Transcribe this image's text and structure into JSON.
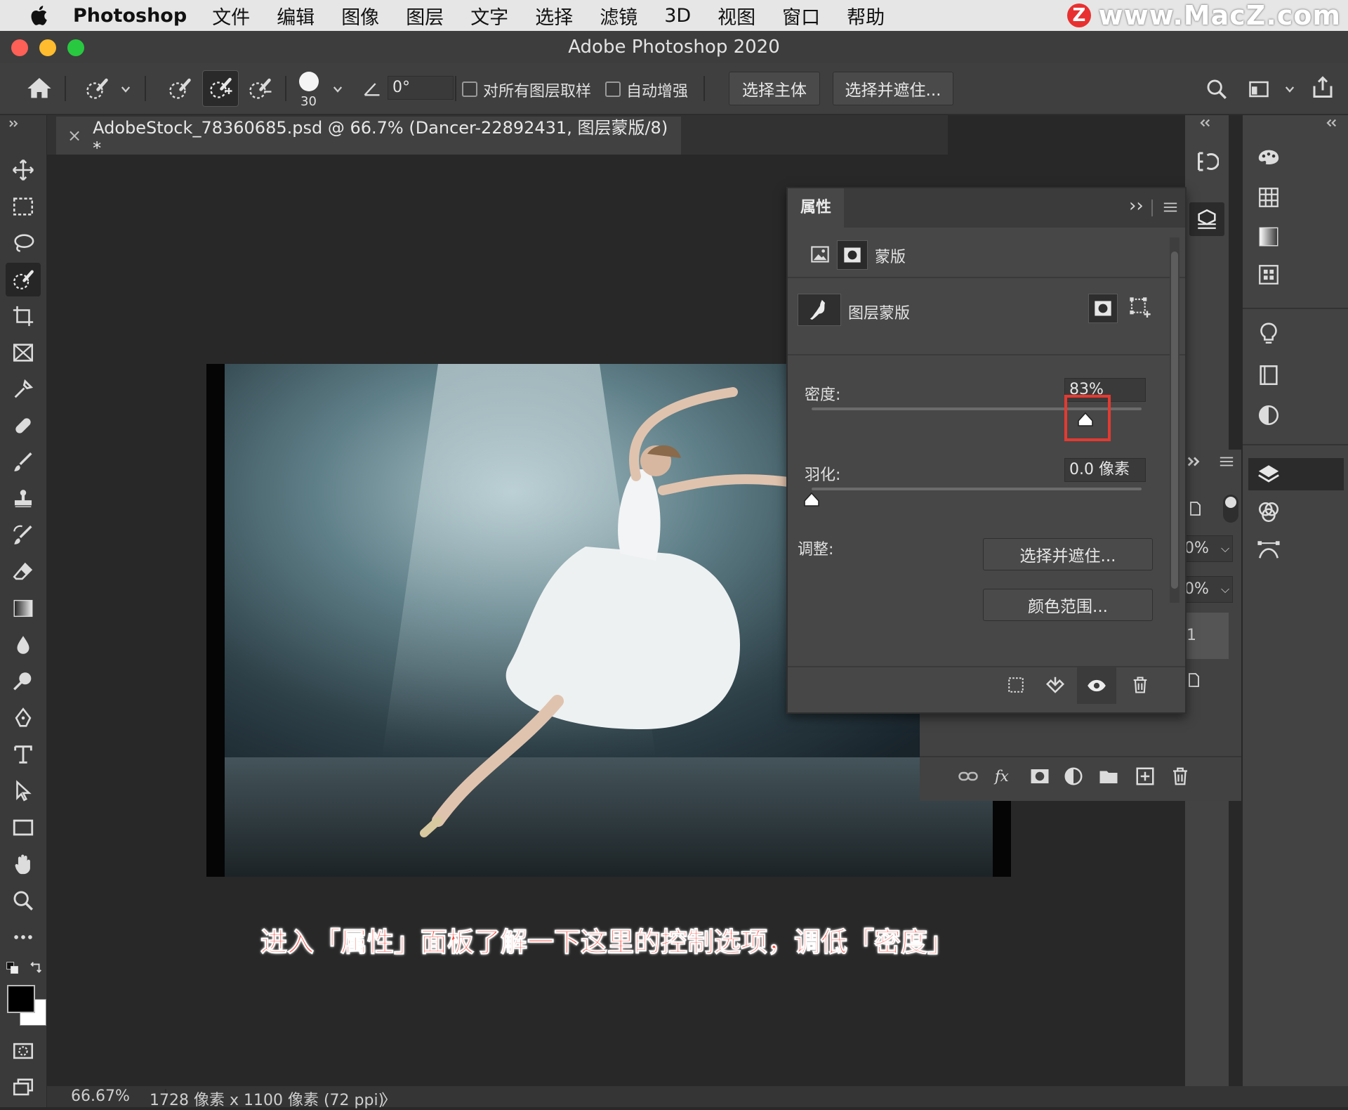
{
  "menubar": {
    "app_name": "Photoshop",
    "items": [
      "文件",
      "编辑",
      "图像",
      "图层",
      "文字",
      "选择",
      "滤镜",
      "3D",
      "视图",
      "窗口",
      "帮助"
    ],
    "watermark": "www.MacZ.com",
    "watermark_badge": "Z"
  },
  "window": {
    "title": "Adobe Photoshop 2020",
    "traffic_colors": [
      "#fe5f57",
      "#febc2e",
      "#28c840"
    ]
  },
  "options_bar": {
    "brush_size": "30",
    "angle_value": "0°",
    "sample_all_layers_label": "对所有图层取样",
    "sample_all_layers_checked": false,
    "auto_enhance_label": "自动增强",
    "auto_enhance_checked": false,
    "select_subject_label": "选择主体",
    "select_and_mask_label": "选择并遮住..."
  },
  "document": {
    "tab_title": "AdobeStock_78360685.psd @ 66.7% (Dancer-22892431, 图层蒙版/8) *",
    "close_glyph": "×"
  },
  "caption": "进入「属性」面板了解一下这里的控制选项，调低「密度」",
  "status_bar": {
    "zoom": "66.67%",
    "doc_info": "1728 像素 x 1100 像素 (72 ppi)",
    "arrow": "〉"
  },
  "properties_panel": {
    "tab_label": "属性",
    "expand_glyph": "››",
    "mask_section_label": "蒙版",
    "layer_mask_label": "图层蒙版",
    "density_label": "密度:",
    "density_value": "83%",
    "density_fraction": 0.83,
    "feather_label": "羽化:",
    "feather_value": "0.0 像素",
    "feather_fraction": 0.0,
    "adjust_label": "调整:",
    "select_and_mask_button": "选择并遮住...",
    "color_range_button": "颜色范围..."
  },
  "layers_panel_partial": {
    "opacity_fragment": "0%",
    "fill_fragment": "0%",
    "layer_fragment": "1"
  },
  "colors": {
    "highlight": "#e33a32",
    "caption": "#ff3b2f",
    "panel_bg": "#474747",
    "app_bg": "#282828"
  }
}
